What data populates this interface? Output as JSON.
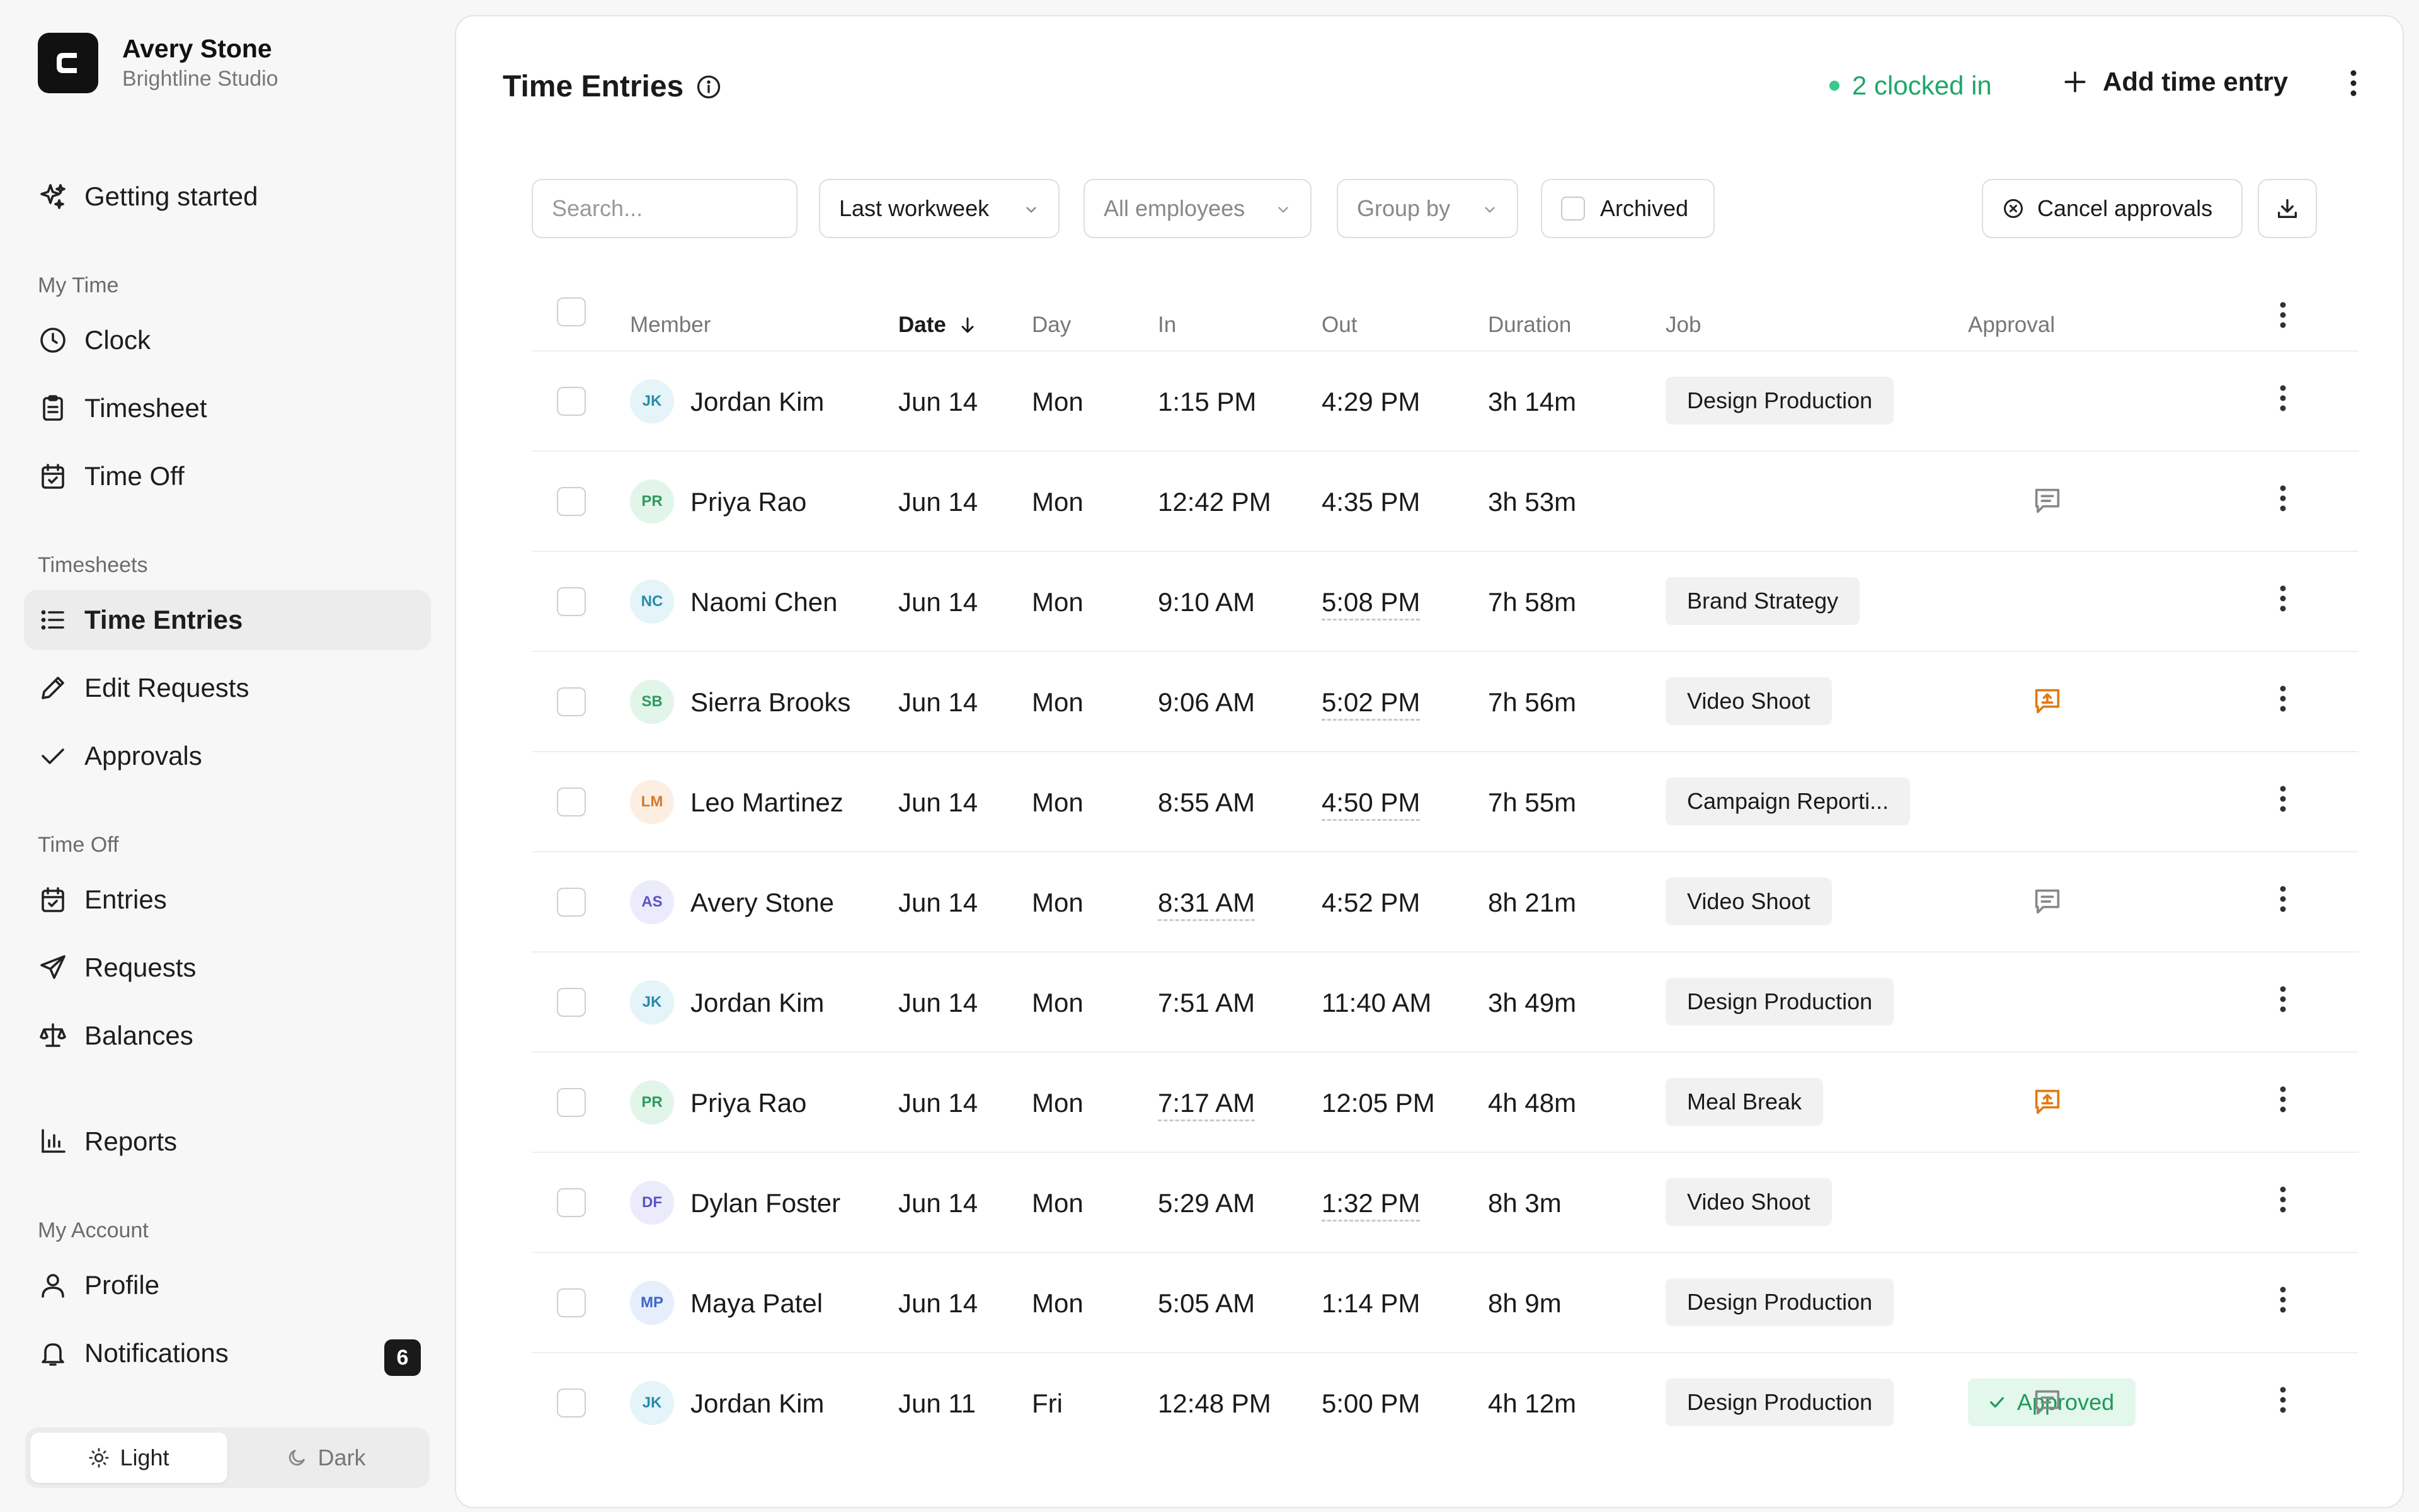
{
  "org": {
    "name": "Avery Stone",
    "subtitle": "Brightline Studio",
    "logo_letter": "C"
  },
  "sidebar": {
    "getting_started": "Getting started",
    "sections": {
      "my_time": "My Time",
      "timesheets": "Timesheets",
      "time_off": "Time Off",
      "my_account": "My Account"
    },
    "items": {
      "clock": "Clock",
      "timesheet": "Timesheet",
      "time_off": "Time Off",
      "time_entries": "Time Entries",
      "edit_requests": "Edit Requests",
      "approvals": "Approvals",
      "entries": "Entries",
      "requests": "Requests",
      "balances": "Balances",
      "reports": "Reports",
      "profile": "Profile",
      "notifications": "Notifications"
    },
    "notifications_badge": "6",
    "theme": {
      "light": "Light",
      "dark": "Dark",
      "selected": "Light"
    }
  },
  "header": {
    "title": "Time Entries",
    "clocked_in": "2 clocked in",
    "add_entry": "Add time entry"
  },
  "filters": {
    "search_placeholder": "Search...",
    "period": "Last workweek",
    "employees": "All employees",
    "group_by": "Group by",
    "archived": "Archived",
    "cancel_approvals": "Cancel approvals"
  },
  "table": {
    "columns": [
      "Member",
      "Date",
      "Day",
      "In",
      "Out",
      "Duration",
      "Job",
      "Approval"
    ],
    "sorted_column": "Date",
    "sort_direction": "descending",
    "rows": [
      {
        "initials": "JK",
        "avatar_color": "teal",
        "member": "Jordan Kim",
        "date": "Jun 14",
        "day": "Mon",
        "in": "1:15 PM",
        "out": "4:29 PM",
        "duration": "3h 14m",
        "job": "Design Production",
        "approval": "",
        "comment": "none",
        "in_dotted": false,
        "out_dotted": false
      },
      {
        "initials": "PR",
        "avatar_color": "green",
        "member": "Priya Rao",
        "date": "Jun 14",
        "day": "Mon",
        "in": "12:42 PM",
        "out": "4:35 PM",
        "duration": "3h 53m",
        "job": "",
        "approval": "",
        "comment": "gray",
        "in_dotted": false,
        "out_dotted": false
      },
      {
        "initials": "NC",
        "avatar_color": "teal",
        "member": "Naomi Chen",
        "date": "Jun 14",
        "day": "Mon",
        "in": "9:10 AM",
        "out": "5:08 PM",
        "duration": "7h 58m",
        "job": "Brand Strategy",
        "approval": "",
        "comment": "none",
        "in_dotted": false,
        "out_dotted": true
      },
      {
        "initials": "SB",
        "avatar_color": "green",
        "member": "Sierra Brooks",
        "date": "Jun 14",
        "day": "Mon",
        "in": "9:06 AM",
        "out": "5:02 PM",
        "duration": "7h 56m",
        "job": "Video Shoot",
        "approval": "",
        "comment": "orange",
        "in_dotted": false,
        "out_dotted": true
      },
      {
        "initials": "LM",
        "avatar_color": "orange",
        "member": "Leo Martinez",
        "date": "Jun 14",
        "day": "Mon",
        "in": "8:55 AM",
        "out": "4:50 PM",
        "duration": "7h 55m",
        "job": "Campaign Reporti...",
        "approval": "",
        "comment": "none",
        "in_dotted": false,
        "out_dotted": true
      },
      {
        "initials": "AS",
        "avatar_color": "purple",
        "member": "Avery Stone",
        "date": "Jun 14",
        "day": "Mon",
        "in": "8:31 AM",
        "out": "4:52 PM",
        "duration": "8h 21m",
        "job": "Video Shoot",
        "approval": "",
        "comment": "gray",
        "in_dotted": true,
        "out_dotted": false
      },
      {
        "initials": "JK",
        "avatar_color": "teal",
        "member": "Jordan Kim",
        "date": "Jun 14",
        "day": "Mon",
        "in": "7:51 AM",
        "out": "11:40 AM",
        "duration": "3h 49m",
        "job": "Design Production",
        "approval": "",
        "comment": "none",
        "in_dotted": false,
        "out_dotted": false
      },
      {
        "initials": "PR",
        "avatar_color": "green",
        "member": "Priya Rao",
        "date": "Jun 14",
        "day": "Mon",
        "in": "7:17 AM",
        "out": "12:05 PM",
        "duration": "4h 48m",
        "job": "Meal Break",
        "approval": "",
        "comment": "orange",
        "in_dotted": true,
        "out_dotted": false
      },
      {
        "initials": "DF",
        "avatar_color": "purple",
        "member": "Dylan Foster",
        "date": "Jun 14",
        "day": "Mon",
        "in": "5:29 AM",
        "out": "1:32 PM",
        "duration": "8h 3m",
        "job": "Video Shoot",
        "approval": "",
        "comment": "none",
        "in_dotted": false,
        "out_dotted": true
      },
      {
        "initials": "MP",
        "avatar_color": "blue",
        "member": "Maya Patel",
        "date": "Jun 14",
        "day": "Mon",
        "in": "5:05 AM",
        "out": "1:14 PM",
        "duration": "8h 9m",
        "job": "Design Production",
        "approval": "",
        "comment": "none",
        "in_dotted": false,
        "out_dotted": false
      },
      {
        "initials": "JK",
        "avatar_color": "teal",
        "member": "Jordan Kim",
        "date": "Jun 11",
        "day": "Fri",
        "in": "12:48 PM",
        "out": "5:00 PM",
        "duration": "4h 12m",
        "job": "Design Production",
        "approval": "Approved",
        "comment": "gray",
        "in_dotted": false,
        "out_dotted": false
      }
    ]
  },
  "colors": {
    "accent_green": "#1fa66a",
    "approved_bg": "#e3f7ec",
    "comment_orange": "#e07b12",
    "avatar": {
      "teal": {
        "bg": "#e4f4f8",
        "fg": "#2a8aa6"
      },
      "green": {
        "bg": "#e2f5ea",
        "fg": "#2e9a5e"
      },
      "orange": {
        "bg": "#fcefe2",
        "fg": "#d27a2c"
      },
      "purple": {
        "bg": "#ecebfb",
        "fg": "#5a54c4"
      },
      "blue": {
        "bg": "#e6eefc",
        "fg": "#3a66c8"
      }
    }
  }
}
